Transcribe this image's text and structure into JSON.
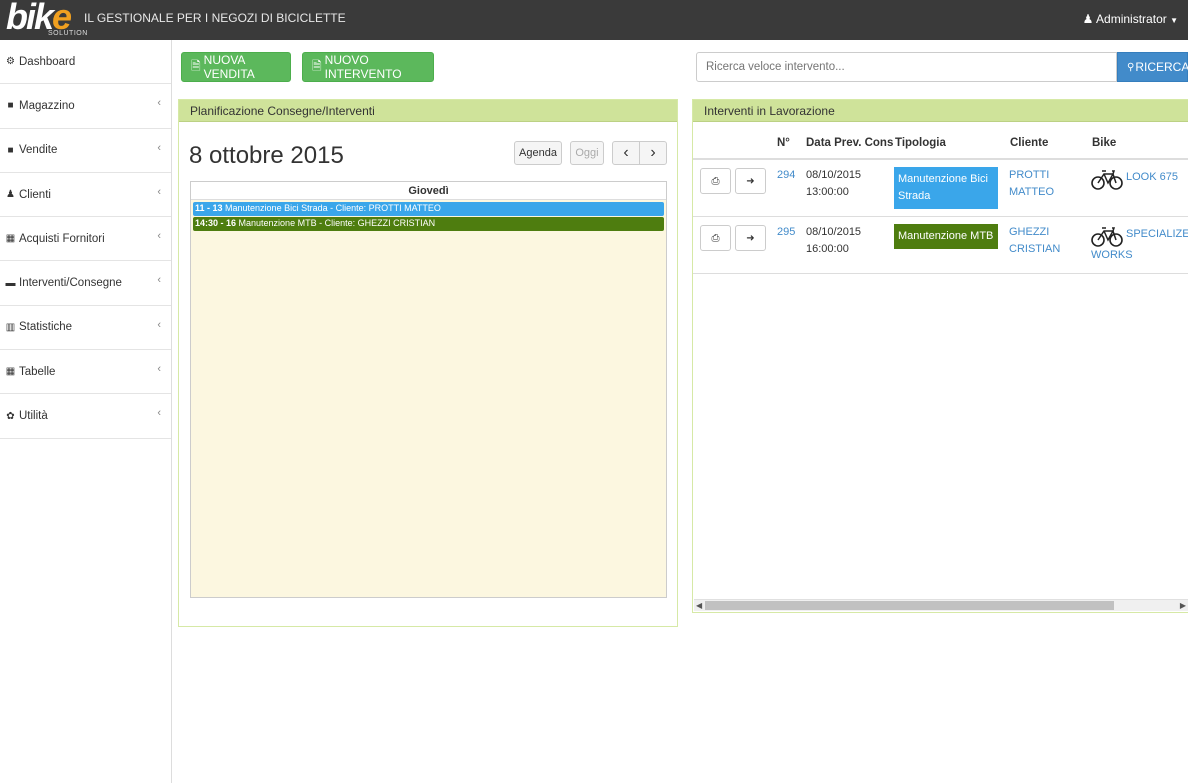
{
  "brand": {
    "logo_main": "bik",
    "logo_e": "e",
    "logo_sub": "SOLUTION",
    "tagline": "IL GESTIONALE PER I NEGOZI DI BICICLETTE"
  },
  "user": {
    "label": "Administrator"
  },
  "sidebar": {
    "items": [
      {
        "label": "Dashboard",
        "icon": "dashboard-icon",
        "glyph": "⚙"
      },
      {
        "label": "Magazzino",
        "icon": "box-icon",
        "glyph": "■"
      },
      {
        "label": "Vendite",
        "icon": "register-icon",
        "glyph": "■"
      },
      {
        "label": "Clienti",
        "icon": "person-icon",
        "glyph": "♟"
      },
      {
        "label": "Acquisti Fornitori",
        "icon": "grid-icon",
        "glyph": "▦"
      },
      {
        "label": "Interventi/Consegne",
        "icon": "folder-icon",
        "glyph": "▬"
      },
      {
        "label": "Statistiche",
        "icon": "bar-chart-icon",
        "glyph": "▥"
      },
      {
        "label": "Tabelle",
        "icon": "grid-icon",
        "glyph": "▦"
      },
      {
        "label": "Utilità",
        "icon": "gear-icon",
        "glyph": "✿"
      }
    ]
  },
  "toolbar": {
    "new_sale": "NUOVA VENDITA",
    "new_job": "NUOVO INTERVENTO"
  },
  "search": {
    "placeholder": "Ricerca veloce intervento...",
    "button": "RICERCA"
  },
  "planning": {
    "title": "Planificazione Consegne/Interventi",
    "date": "8 ottobre 2015",
    "btn_agenda": "Agenda",
    "btn_today": "Oggi",
    "btn_prev": "‹",
    "btn_next": "›",
    "day_name": "Giovedì",
    "events": [
      {
        "time": "11 - 13",
        "text": " Manutenzione Bici Strada - Cliente: PROTTI MATTEO",
        "color": "#3aa6ea"
      },
      {
        "time": "14:30 - 16",
        "text": " Manutenzione MTB - Cliente: GHEZZI CRISTIAN",
        "color": "#4e7d0f"
      }
    ]
  },
  "jobs": {
    "title": "Interventi in Lavorazione",
    "headers": {
      "num": "N°",
      "date": "Data Prev. Cons",
      "type": "Tipologia",
      "client": "Cliente",
      "bike": "Bike"
    },
    "rows": [
      {
        "num": "294",
        "date": "08/10/2015",
        "time": "13:00:00",
        "type_line1": "Manutenzione Bici",
        "type_line2": "Strada",
        "type_color": "#3aa6ea",
        "client_line1": "PROTTI",
        "client_line2": "MATTEO",
        "bike_line1": "LOOK 675",
        "bike_line2": ""
      },
      {
        "num": "295",
        "date": "08/10/2015",
        "time": "16:00:00",
        "type_line1": "Manutenzione MTB",
        "type_line2": "",
        "type_color": "#4e7d0f",
        "client_line1": "GHEZZI",
        "client_line2": "CRISTIAN",
        "bike_line1": "SPECIALIZED",
        "bike_line2": "WORKS"
      }
    ]
  }
}
